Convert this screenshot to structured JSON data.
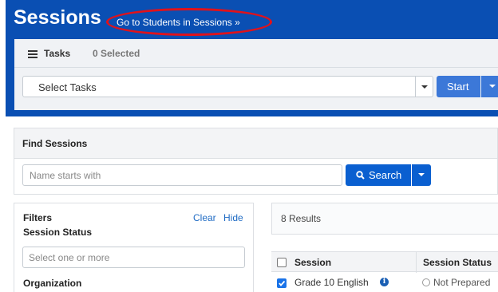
{
  "header": {
    "title": "Sessions",
    "goto_link": "Go to Students in Sessions »",
    "highlight_color": "#e0121b",
    "background_color": "#0a4fb3"
  },
  "tasks": {
    "icon": "tasks-list-icon",
    "label": "Tasks",
    "selected_count": "0 Selected",
    "select_value": "Select Tasks",
    "start_label": "Start"
  },
  "find": {
    "title": "Find Sessions",
    "search_placeholder": "Name starts with",
    "search_label": "Search"
  },
  "filters": {
    "title": "Filters",
    "clear_label": "Clear",
    "hide_label": "Hide",
    "status_label": "Session Status",
    "status_placeholder": "Select one or more",
    "organization_label": "Organization"
  },
  "results": {
    "count_text": "8 Results",
    "columns": [
      "Session",
      "Session Status"
    ],
    "rows": [
      {
        "session": "Grade 10 English",
        "status": "Not Prepared",
        "checked": true
      }
    ]
  }
}
